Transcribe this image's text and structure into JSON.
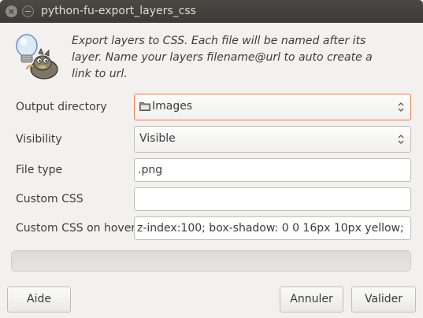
{
  "window": {
    "title": "python-fu-export_layers_css"
  },
  "icons": {
    "main": "gimp-wilber-lightbulb-icon",
    "close": "close-icon",
    "minimize": "minimize-icon",
    "folder": "folder-icon",
    "spin": "up-down-arrows-icon"
  },
  "description": "Export layers to CSS. Each file will be named after its layer. Name your layers filename@url to auto create a link to url.",
  "form": {
    "output_directory": {
      "label": "Output directory",
      "value": "Images"
    },
    "visibility": {
      "label": "Visibility",
      "value": "Visible"
    },
    "file_type": {
      "label": "File type",
      "value": ".png"
    },
    "custom_css": {
      "label": "Custom CSS",
      "value": ""
    },
    "custom_css_hover": {
      "label": "Custom CSS on hover",
      "value": "z-index:100; box-shadow: 0 0 16px 10px yellow;"
    }
  },
  "progress": {
    "fraction": 0
  },
  "buttons": {
    "help": "Aide",
    "cancel": "Annuler",
    "ok": "Valider"
  },
  "colors": {
    "titlebar": "#3c3b37",
    "focus_border": "#e37d49",
    "background": "#f2f1f0"
  }
}
